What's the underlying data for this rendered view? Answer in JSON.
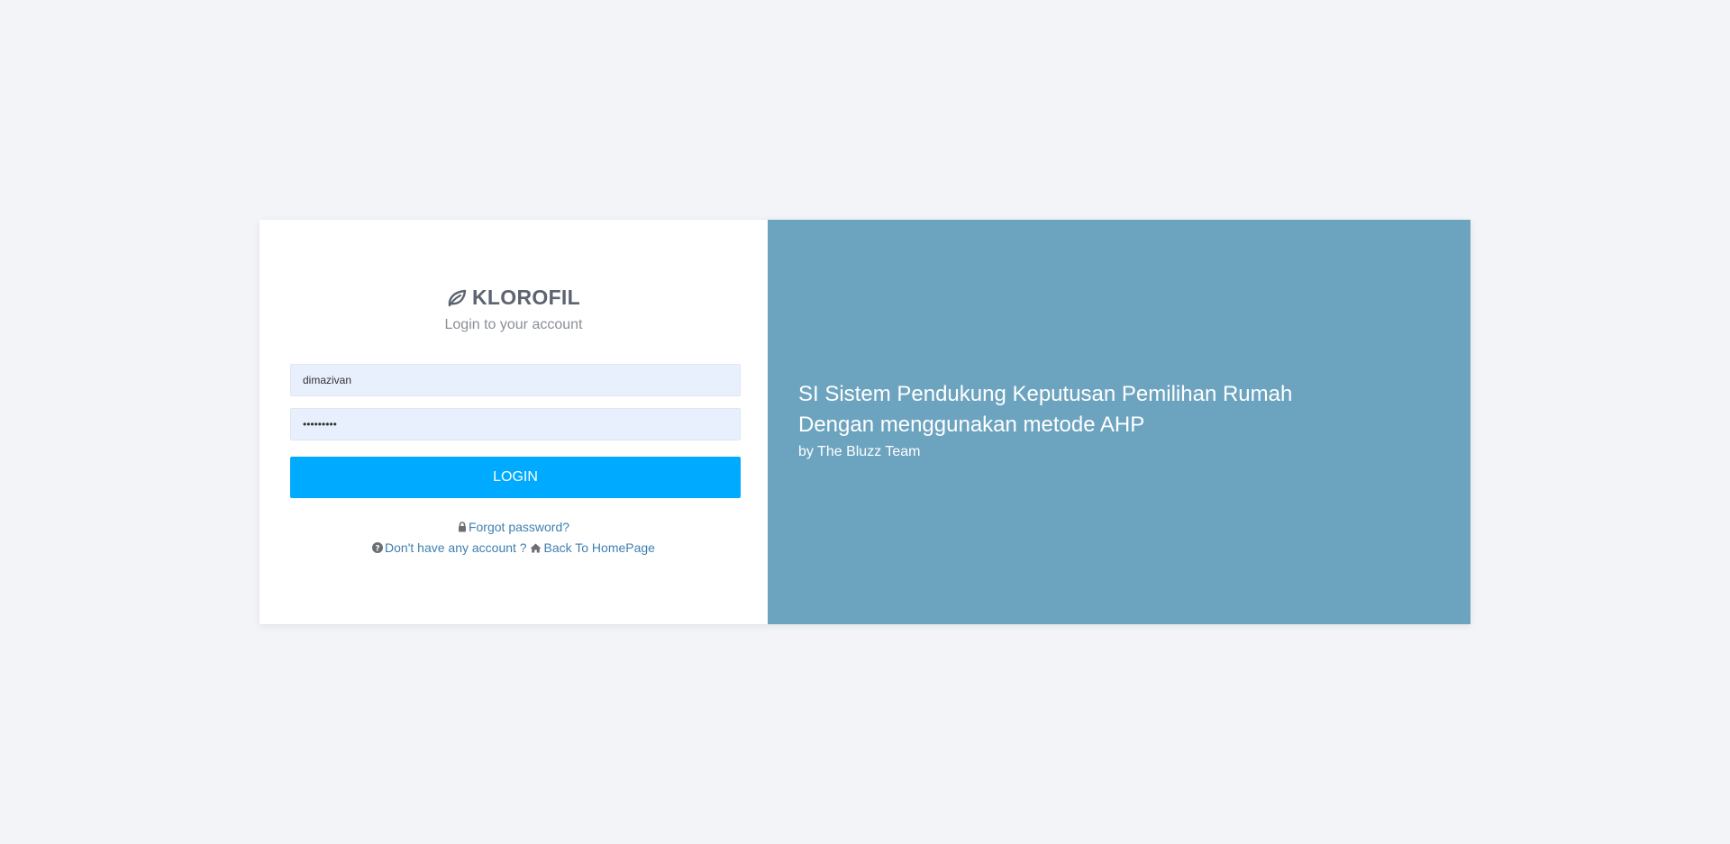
{
  "brand": {
    "name": "KLOROFIL",
    "subtitle": "Login to your account"
  },
  "form": {
    "username_value": "dimazivan",
    "password_value": "•••••••••",
    "login_label": "LOGIN"
  },
  "links": {
    "forgot_password": "Forgot password?",
    "no_account": "Don't have any account ?",
    "back_home": "Back To HomePage"
  },
  "promo": {
    "line1": "SI Sistem Pendukung Keputusan Pemilihan Rumah",
    "line2": "Dengan menggunakan metode AHP",
    "byline": "by The Bluzz Team"
  },
  "colors": {
    "background": "#f2f4f8",
    "panel_right": "#6ca4c0",
    "button": "#00aaff",
    "link": "#3f7fb0",
    "input_fill": "#e8f0fe"
  },
  "icons": {
    "logo": "leaf-icon",
    "forgot": "lock-icon",
    "no_account": "question-circle-icon",
    "home": "home-icon"
  }
}
